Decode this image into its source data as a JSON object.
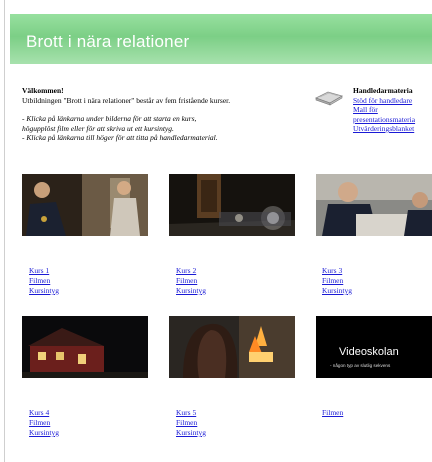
{
  "banner": {
    "title": "Brott i nära relationer"
  },
  "intro": {
    "heading": "Välkommen!",
    "line1": "Utbildningen \"Brott i nära relationer\" består av fem fristående kurser.",
    "instr1": "- Klicka på länkarna under bilderna för att starta en kurs,",
    "instr2": "högupplöst film eller för att skriva ut ett kursintyg.",
    "instr3": "- Klicka på länkarna till höger för att titta på handledarmaterial."
  },
  "handledare": {
    "title": "Handledarmateria",
    "links": [
      "Stöd för handledare",
      "Mall för",
      "presentationsmateria",
      "Utvärderingsblanket"
    ]
  },
  "courses": [
    {
      "label": "Kurs 1",
      "film": "Filmen",
      "cert": "Kursintyg"
    },
    {
      "label": "Kurs 2",
      "film": "Filmen",
      "cert": "Kursintyg"
    },
    {
      "label": "Kurs 3",
      "film": "Filmen",
      "cert": "Kursintyg"
    },
    {
      "label": "Kurs 4",
      "film": "Filmen",
      "cert": "Kursintyg"
    },
    {
      "label": "Kurs 5",
      "film": "Filmen",
      "cert": "Kursintyg"
    }
  ],
  "videoskolan": {
    "title": "Videoskolan",
    "subtitle": "- någon typ av slutlig sekvens",
    "film": "Filmen"
  },
  "colors": {
    "banner": "#7ccf86",
    "link": "#1a1ad6"
  }
}
